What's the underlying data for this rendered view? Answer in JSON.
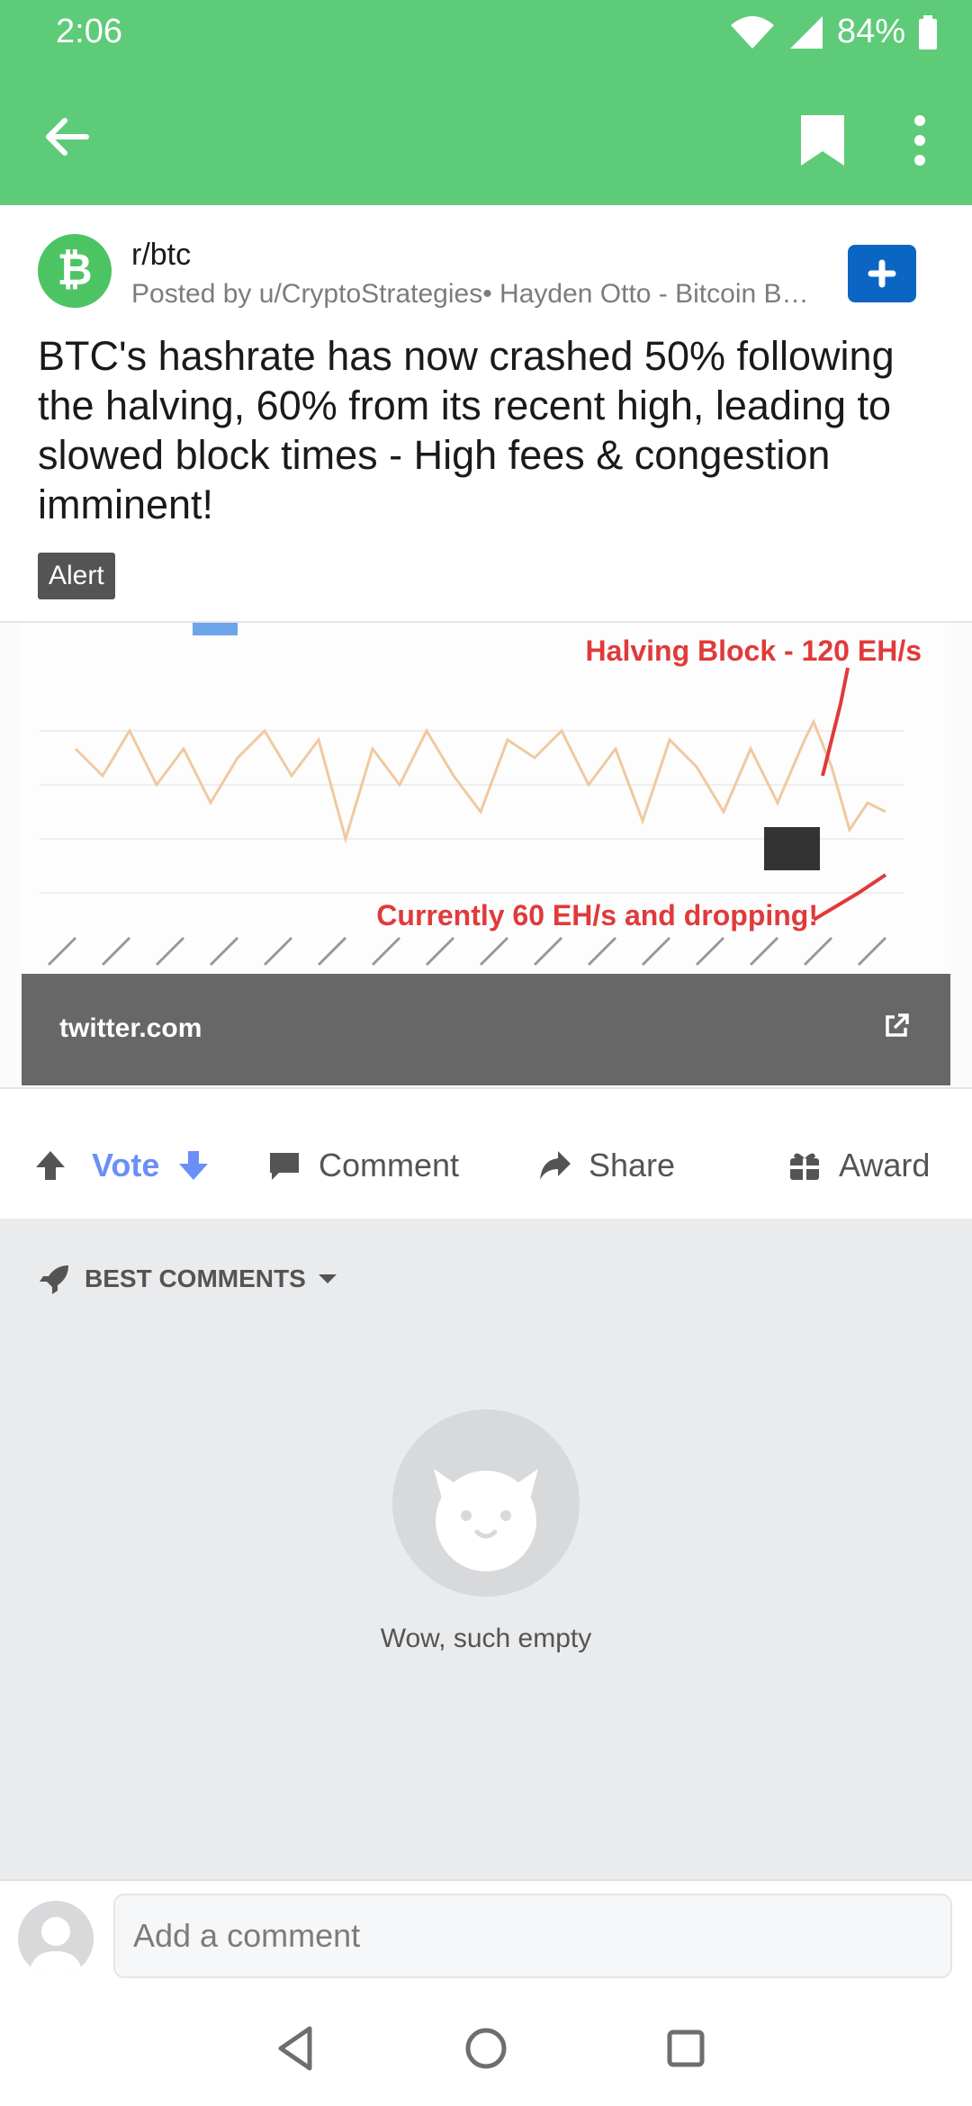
{
  "status": {
    "time": "2:06",
    "battery": "84%"
  },
  "appbar": {
    "back_icon": "arrow-left-icon",
    "bookmark_icon": "bookmark-icon",
    "more_icon": "more-vert-icon"
  },
  "post": {
    "subreddit": "r/btc",
    "posted_by": "Posted by u/CryptoStrategies• Hayden Otto - Bitcoin B…",
    "title": "BTC's hashrate has now crashed 50% following the halving, 60% from its recent high, leading to slowed block times - High fees & congestion imminent!",
    "flair": "Alert",
    "preview": {
      "annotation_top": "Halving Block - 120 EH/s",
      "annotation_bottom": "Currently 60 EH/s and dropping!",
      "domain": "twitter.com"
    }
  },
  "actions": {
    "vote": "Vote",
    "comment": "Comment",
    "share": "Share",
    "award": "Award"
  },
  "comments": {
    "sort_label": "BEST COMMENTS",
    "empty_text": "Wow, such empty"
  },
  "composer": {
    "placeholder": "Add a comment"
  },
  "colors": {
    "header_green": "#5ecb78",
    "vote_blue": "#6a8ff7",
    "join_blue": "#0a66c2",
    "annotation_red": "#e03a3a"
  }
}
